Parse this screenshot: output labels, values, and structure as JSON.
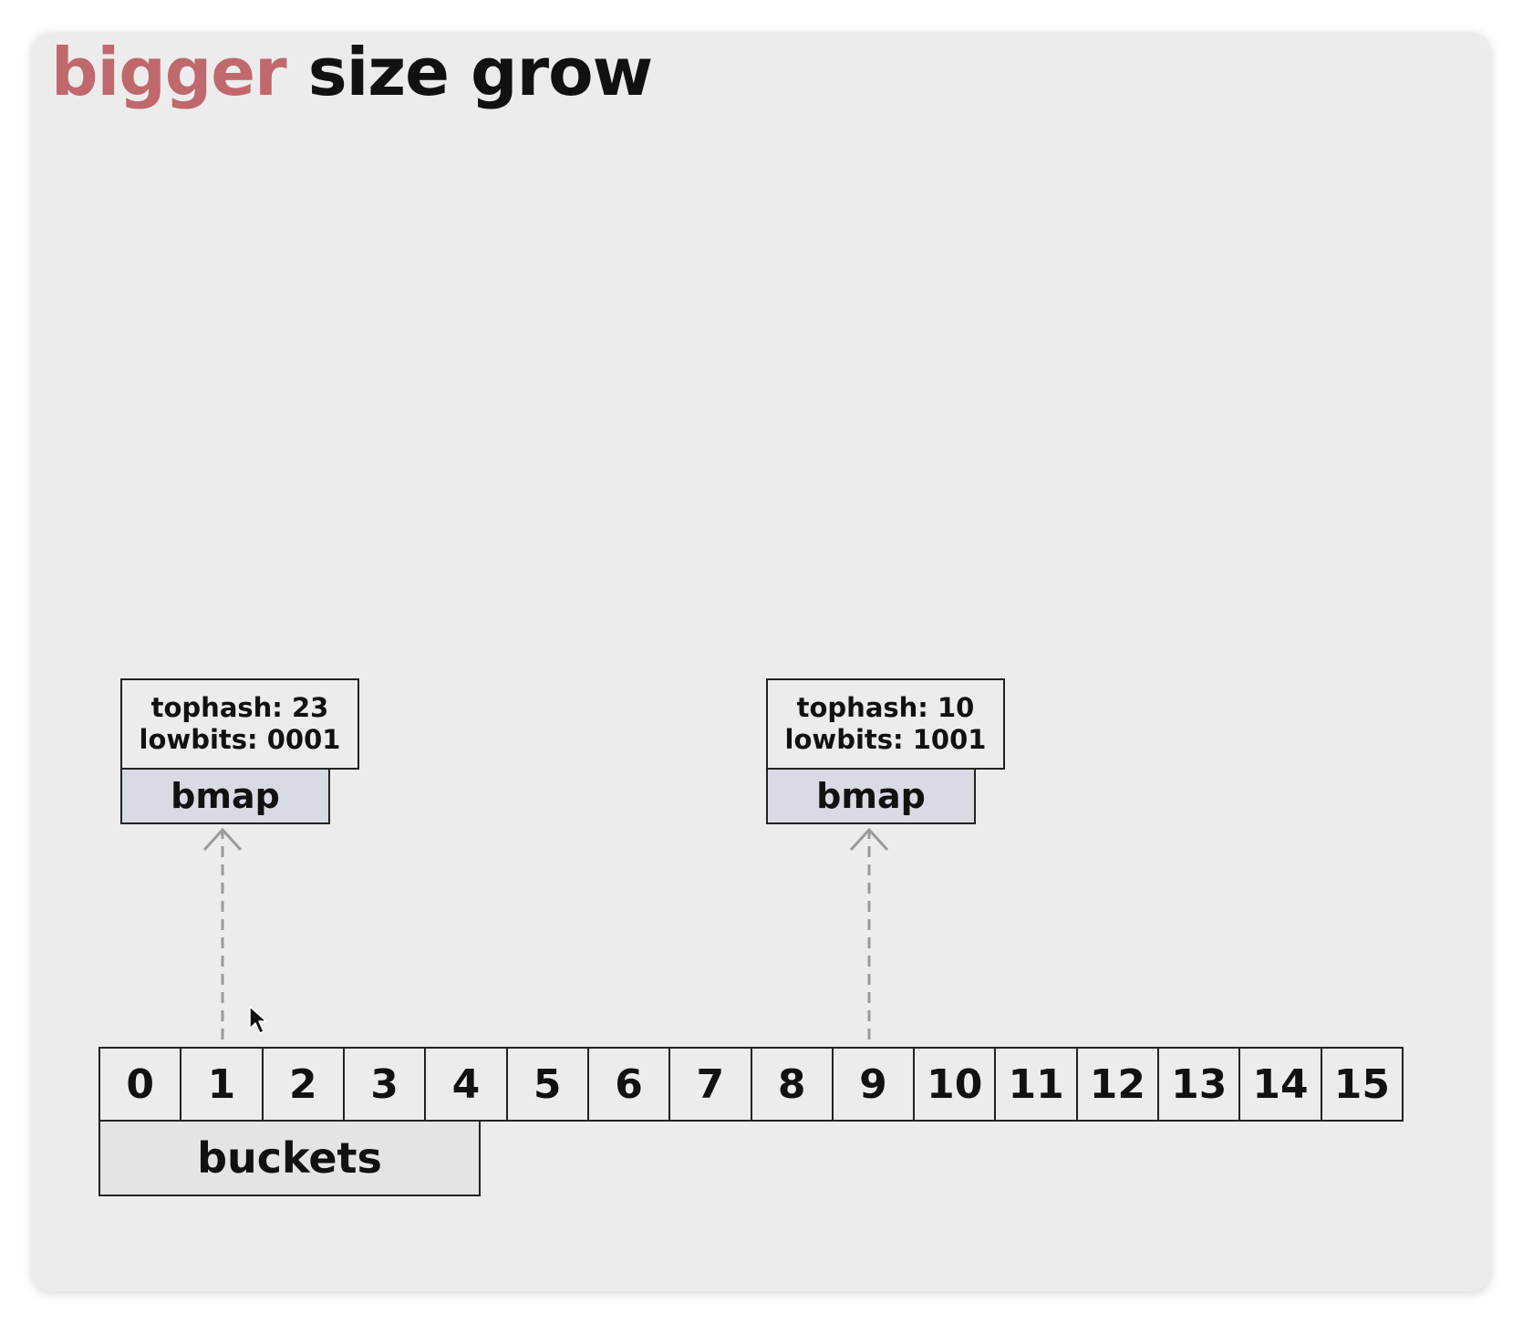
{
  "title": {
    "accent": "bigger",
    "rest": "size grow",
    "accent_color": "#c0686c"
  },
  "entries": [
    {
      "tophash": "tophash: 23",
      "lowbits": "lowbits: 0001",
      "label": "bmap",
      "bucket": "1"
    },
    {
      "tophash": "tophash: 10",
      "lowbits": "lowbits: 1001",
      "label": "bmap",
      "bucket": "9"
    }
  ],
  "buckets": {
    "cells": [
      "0",
      "1",
      "2",
      "3",
      "4",
      "5",
      "6",
      "7",
      "8",
      "9",
      "10",
      "11",
      "12",
      "13",
      "14",
      "15"
    ],
    "label": "buckets"
  },
  "colors": {
    "slide_background": "#ececec",
    "bmap_fill": "#d8dbe4",
    "outline": "#222222",
    "arrow": "#9a9a9a"
  },
  "icons": {
    "pointer": "mouse-pointer-icon",
    "arrow": "dashed-arrow-up-icon"
  }
}
